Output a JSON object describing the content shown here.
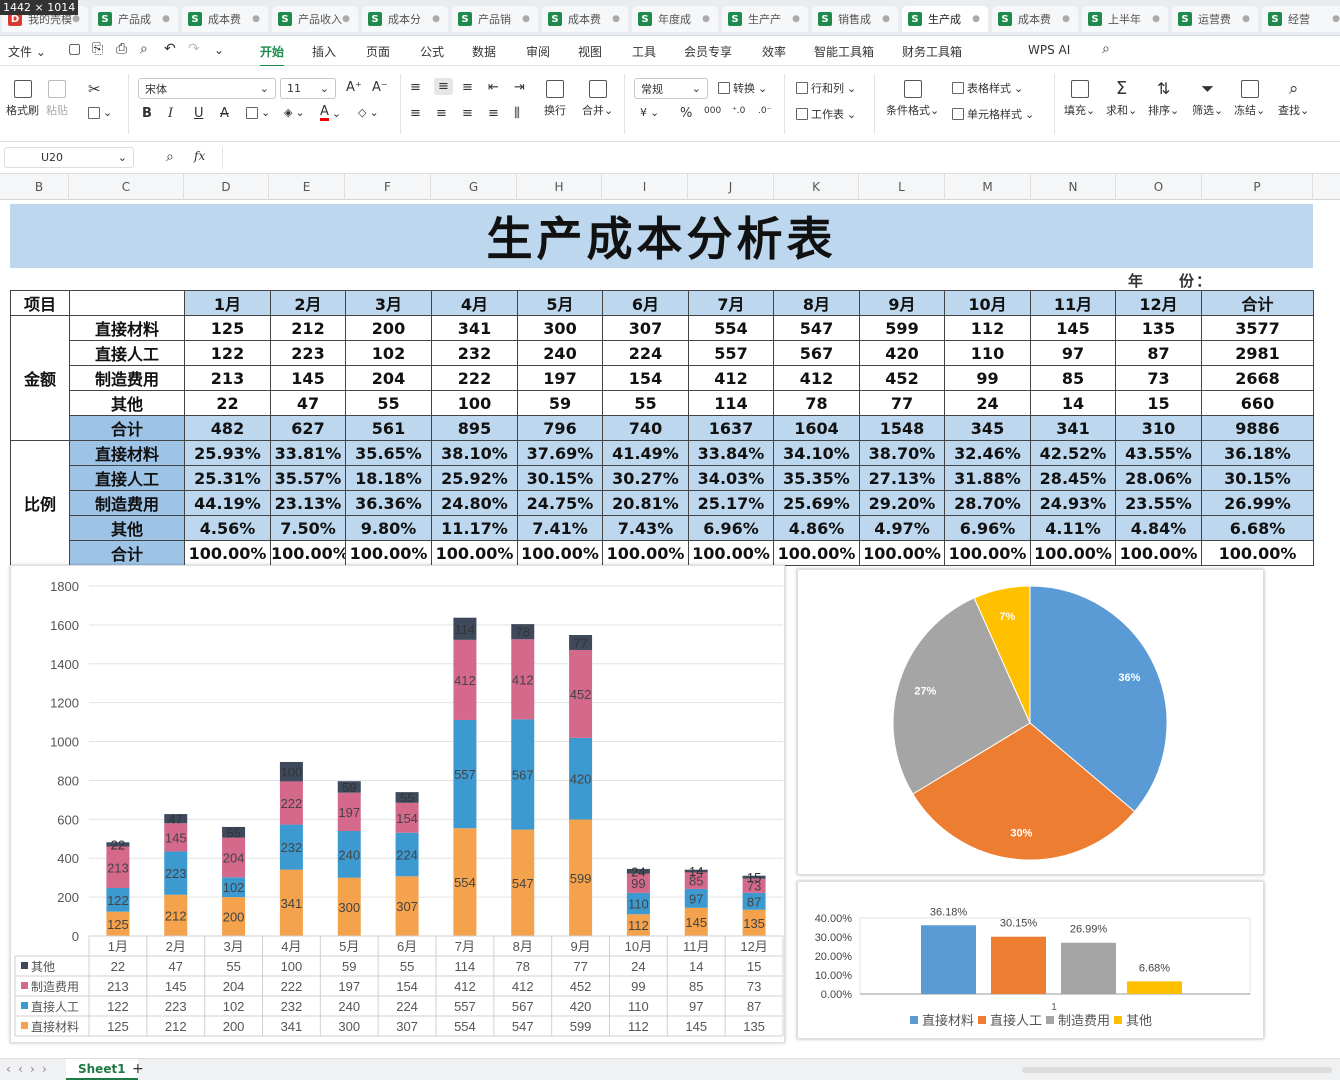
{
  "window": {
    "size_badge": "1442 × 1014"
  },
  "tabs": [
    {
      "label": "我的壳模",
      "icon": "D"
    },
    {
      "label": "产品成",
      "icon": "S"
    },
    {
      "label": "成本费",
      "icon": "S"
    },
    {
      "label": "产品收入",
      "icon": "S"
    },
    {
      "label": "成本分",
      "icon": "S"
    },
    {
      "label": "产品销",
      "icon": "S"
    },
    {
      "label": "成本费",
      "icon": "S"
    },
    {
      "label": "年度成",
      "icon": "S"
    },
    {
      "label": "生产产",
      "icon": "S"
    },
    {
      "label": "销售成",
      "icon": "S"
    },
    {
      "label": "生产成",
      "icon": "S",
      "active": true
    },
    {
      "label": "成本费",
      "icon": "S"
    },
    {
      "label": "上半年",
      "icon": "S"
    },
    {
      "label": "运营费",
      "icon": "S"
    },
    {
      "label": "经营",
      "icon": "S"
    }
  ],
  "menu": {
    "file": "文件",
    "items": [
      "开始",
      "插入",
      "页面",
      "公式",
      "数据",
      "审阅",
      "视图",
      "工具",
      "会员专享",
      "效率",
      "智能工具箱",
      "财务工具箱",
      "WPS AI"
    ],
    "active": "开始"
  },
  "ribbon": {
    "format_painter": "格式刷",
    "paste": "粘贴",
    "font_name": "宋体",
    "font_size": "11",
    "bold": "B",
    "italic": "I",
    "underline": "U",
    "strike": "A",
    "wrap": "换行",
    "merge": "合并",
    "number_format": "常规",
    "convert": "转换",
    "rows_cols": "行和列",
    "worksheet": "工作表",
    "cond_format": "条件格式",
    "table_style": "表格样式",
    "cell_style": "单元格样式",
    "fill": "填充",
    "sum": "求和",
    "sort": "排序",
    "filter": "筛选",
    "freeze": "冻结",
    "find": "查找",
    "currency": "¥",
    "percent": "%"
  },
  "formula_bar": {
    "cell_ref": "U20",
    "fx": "fx"
  },
  "columns": [
    "B",
    "C",
    "D",
    "E",
    "F",
    "G",
    "H",
    "I",
    "J",
    "K",
    "L",
    "M",
    "N",
    "O",
    "P"
  ],
  "sheet": {
    "title": "生产成本分析表",
    "year_label": "年　　份：",
    "header": [
      "项目",
      "",
      "1月",
      "2月",
      "3月",
      "4月",
      "5月",
      "6月",
      "7月",
      "8月",
      "9月",
      "10月",
      "11月",
      "12月",
      "合计"
    ],
    "group_amount": "金额",
    "group_ratio": "比例",
    "amount_rows": [
      {
        "label": "直接材料",
        "values": [
          "125",
          "212",
          "200",
          "341",
          "300",
          "307",
          "554",
          "547",
          "599",
          "112",
          "145",
          "135",
          "3577"
        ]
      },
      {
        "label": "直接人工",
        "values": [
          "122",
          "223",
          "102",
          "232",
          "240",
          "224",
          "557",
          "567",
          "420",
          "110",
          "97",
          "87",
          "2981"
        ]
      },
      {
        "label": "制造费用",
        "values": [
          "213",
          "145",
          "204",
          "222",
          "197",
          "154",
          "412",
          "412",
          "452",
          "99",
          "85",
          "73",
          "2668"
        ]
      },
      {
        "label": "其他",
        "values": [
          "22",
          "47",
          "55",
          "100",
          "59",
          "55",
          "114",
          "78",
          "77",
          "24",
          "14",
          "15",
          "660"
        ]
      },
      {
        "label": "合计",
        "values": [
          "482",
          "627",
          "561",
          "895",
          "796",
          "740",
          "1637",
          "1604",
          "1548",
          "345",
          "341",
          "310",
          "9886"
        ]
      }
    ],
    "ratio_rows": [
      {
        "label": "直接材料",
        "values": [
          "25.93%",
          "33.81%",
          "35.65%",
          "38.10%",
          "37.69%",
          "41.49%",
          "33.84%",
          "34.10%",
          "38.70%",
          "32.46%",
          "42.52%",
          "43.55%",
          "36.18%"
        ]
      },
      {
        "label": "直接人工",
        "values": [
          "25.31%",
          "35.57%",
          "18.18%",
          "25.92%",
          "30.15%",
          "30.27%",
          "34.03%",
          "35.35%",
          "27.13%",
          "31.88%",
          "28.45%",
          "28.06%",
          "30.15%"
        ]
      },
      {
        "label": "制造费用",
        "values": [
          "44.19%",
          "23.13%",
          "36.36%",
          "24.80%",
          "24.75%",
          "20.81%",
          "25.17%",
          "25.69%",
          "29.20%",
          "28.70%",
          "24.93%",
          "23.55%",
          "26.99%"
        ]
      },
      {
        "label": "其他",
        "values": [
          "4.56%",
          "7.50%",
          "9.80%",
          "11.17%",
          "7.41%",
          "7.43%",
          "6.96%",
          "4.86%",
          "4.97%",
          "6.96%",
          "4.11%",
          "4.84%",
          "6.68%"
        ]
      },
      {
        "label": "合计",
        "values": [
          "100.00%",
          "100.00%",
          "100.00%",
          "100.00%",
          "100.00%",
          "100.00%",
          "100.00%",
          "100.00%",
          "100.00%",
          "100.00%",
          "100.00%",
          "100.00%",
          "100.00%"
        ]
      }
    ]
  },
  "colors": {
    "direct_material": "#f4a24c",
    "direct_labor": "#3d9ad1",
    "manufacturing": "#d4698b",
    "other": "#3e4a5c",
    "pie_material": "#5b9bd5",
    "pie_labor": "#ed7d31",
    "pie_mfg": "#a5a5a5",
    "pie_other": "#ffc000",
    "header_blue": "#bdd7ee",
    "label_blue": "#9dc3e6"
  },
  "chart_data": [
    {
      "type": "bar",
      "stacked": true,
      "categories": [
        "1月",
        "2月",
        "3月",
        "4月",
        "5月",
        "6月",
        "7月",
        "8月",
        "9月",
        "10月",
        "11月",
        "12月"
      ],
      "series": [
        {
          "name": "直接材料",
          "values": [
            125,
            212,
            200,
            341,
            300,
            307,
            554,
            547,
            599,
            112,
            145,
            135
          ]
        },
        {
          "name": "直接人工",
          "values": [
            122,
            223,
            102,
            232,
            240,
            224,
            557,
            567,
            420,
            110,
            97,
            87
          ]
        },
        {
          "name": "制造费用",
          "values": [
            213,
            145,
            204,
            222,
            197,
            154,
            412,
            412,
            452,
            99,
            85,
            73
          ]
        },
        {
          "name": "其他",
          "values": [
            22,
            47,
            55,
            100,
            59,
            55,
            114,
            78,
            77,
            24,
            14,
            15
          ]
        }
      ],
      "ylim": [
        0,
        1800
      ],
      "yticks": [
        0,
        200,
        400,
        600,
        800,
        1000,
        1200,
        1400,
        1600,
        1800
      ],
      "data_table": true,
      "grid": true
    },
    {
      "type": "pie",
      "categories": [
        "直接材料",
        "直接人工",
        "制造费用",
        "其他"
      ],
      "values": [
        36.18,
        30.15,
        26.99,
        6.68
      ],
      "labels": [
        "36%",
        "30%",
        "27%",
        "7%"
      ]
    },
    {
      "type": "bar",
      "categories": [
        "直接材料",
        "直接人工",
        "制造费用",
        "其他"
      ],
      "values": [
        36.18,
        30.15,
        26.99,
        6.68
      ],
      "value_labels": [
        "36.18%",
        "30.15%",
        "26.99%",
        "6.68%"
      ],
      "ylim": [
        0,
        40
      ],
      "yticks": [
        "0.00%",
        "10.00%",
        "20.00%",
        "30.00%",
        "40.00%"
      ],
      "x_category": "1",
      "legend": "bottom"
    }
  ],
  "statusbar": {
    "sheet_tab": "Sheet1",
    "add": "+"
  }
}
